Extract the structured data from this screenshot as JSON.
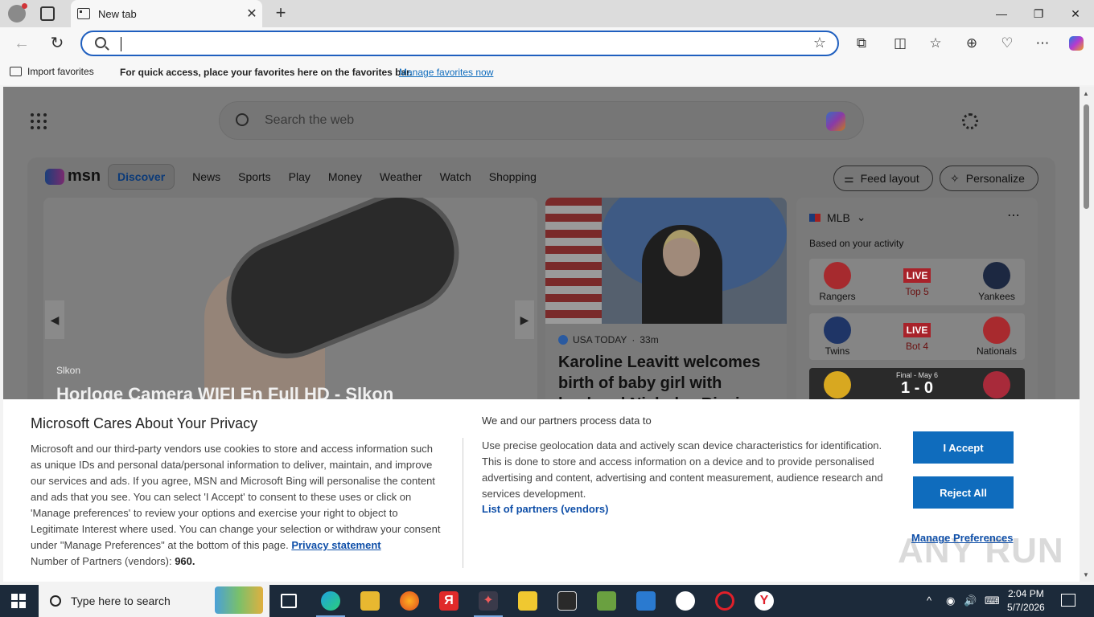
{
  "browser": {
    "tab_title": "New tab",
    "address_value": "",
    "favbar": {
      "import_label": "Import favorites",
      "prompt": "For quick access, place your favorites here on the favorites bar.",
      "manage_link": "Manage favorites now"
    }
  },
  "msn": {
    "search_placeholder": "Search the web",
    "logo": "msn",
    "nav": [
      "Discover",
      "News",
      "Sports",
      "Play",
      "Money",
      "Weather",
      "Watch",
      "Shopping"
    ],
    "feed_layout_label": "Feed layout",
    "personalize_label": "Personalize",
    "hero": {
      "source": "Slkon",
      "title": "Horloge Camera WIFI En Full HD - Slkon"
    },
    "story": {
      "source": "USA TODAY",
      "age": "33m",
      "title": "Karoline Leavitt welcomes birth of baby girl with husband Nicholas Riccio"
    },
    "sports": {
      "league": "MLB",
      "subtitle": "Based on your activity",
      "games": [
        {
          "home": "Rangers",
          "away": "Yankees",
          "status": "LIVE",
          "detail": "Top 5",
          "home_color": "#a62a2e",
          "away_color": "#1c2841"
        },
        {
          "home": "Twins",
          "away": "Nationals",
          "status": "LIVE",
          "detail": "Bot 4",
          "home_color": "#1f3566",
          "away_color": "#a82a2e"
        },
        {
          "home": "",
          "away": "",
          "status": "Final - May 6",
          "detail": "1 - 0",
          "home_color": "#d8a820",
          "away_color": "#a82a3a"
        }
      ]
    }
  },
  "consent": {
    "title": "Microsoft Cares About Your Privacy",
    "body": "Microsoft and our third-party vendors use cookies to store and access information such as unique IDs and personal data/personal information to deliver, maintain, and improve our services and ads. If you agree, MSN and Microsoft Bing will personalise the content and ads that you see. You can select 'I Accept' to consent to these uses or click on 'Manage preferences' to review your options and exercise your right to object to Legitimate Interest where used. You can change your selection or withdraw your consent under \"Manage Preferences\" at the bottom of this page.",
    "privacy_link": "Privacy statement",
    "partners_label": "Number of Partners (vendors):",
    "partners_count": "960.",
    "right_title": "We and our partners process data to",
    "right_body": "Use precise geolocation data and actively scan device characteristics for identification. This is done to store and access information on a device and to provide personalised advertising and content, advertising and content measurement, audience research and services development.",
    "vendors_link": "List of partners (vendors)",
    "accept": "I Accept",
    "reject": "Reject All",
    "manage": "Manage Preferences",
    "watermark": "ANY RUN"
  },
  "taskbar": {
    "search_placeholder": "Type here to search",
    "time": "2:04 PM",
    "date": "5/7/2026"
  }
}
